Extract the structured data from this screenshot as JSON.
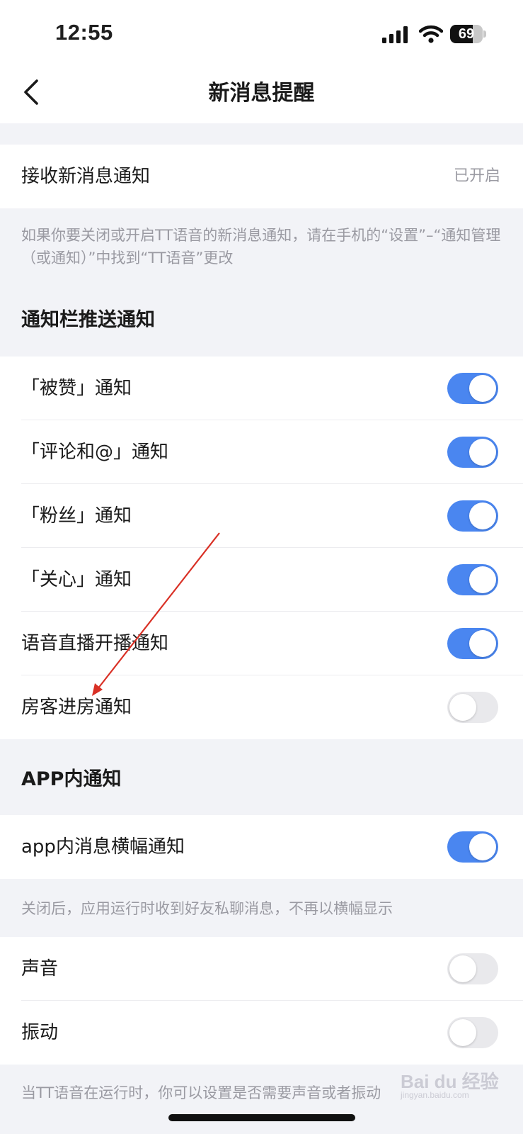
{
  "status_bar": {
    "time": "12:55",
    "battery": "69",
    "battery_level": 0.69
  },
  "nav": {
    "title": "新消息提醒",
    "back_icon": "chevron-left-icon"
  },
  "receive": {
    "label": "接收新消息通知",
    "value": "已开启"
  },
  "receive_hint": "如果你要关闭或开启TT语音的新消息通知，请在手机的“设置”–“通知管理（或通知）”中找到“TT语音”更改",
  "push_section": {
    "title": "通知栏推送通知",
    "items": [
      {
        "label": "「被赞」通知",
        "on": true
      },
      {
        "label": "「评论和@」通知",
        "on": true
      },
      {
        "label": "「粉丝」通知",
        "on": true
      },
      {
        "label": "「关心」通知",
        "on": true
      },
      {
        "label": "语音直播开播通知",
        "on": true
      },
      {
        "label": "房客进房通知",
        "on": false
      }
    ]
  },
  "app_section": {
    "title": "APP内通知",
    "banner": {
      "label": "app内消息横幅通知",
      "on": true
    },
    "hint": "关闭后，应用运行时收到好友私聊消息，不再以横幅显示",
    "sound": {
      "label": "声音",
      "on": false
    },
    "vibrate": {
      "label": "振动",
      "on": false
    },
    "bottom_hint": "当TT语音在运行时，你可以设置是否需要声音或者振动"
  },
  "watermark": {
    "text": "Bai du 经验",
    "sub": "jingyan.baidu.com"
  },
  "colors": {
    "accent": "#4a86f0",
    "toggle_off": "#e9e9ec",
    "annotation_arrow": "#d93025"
  }
}
